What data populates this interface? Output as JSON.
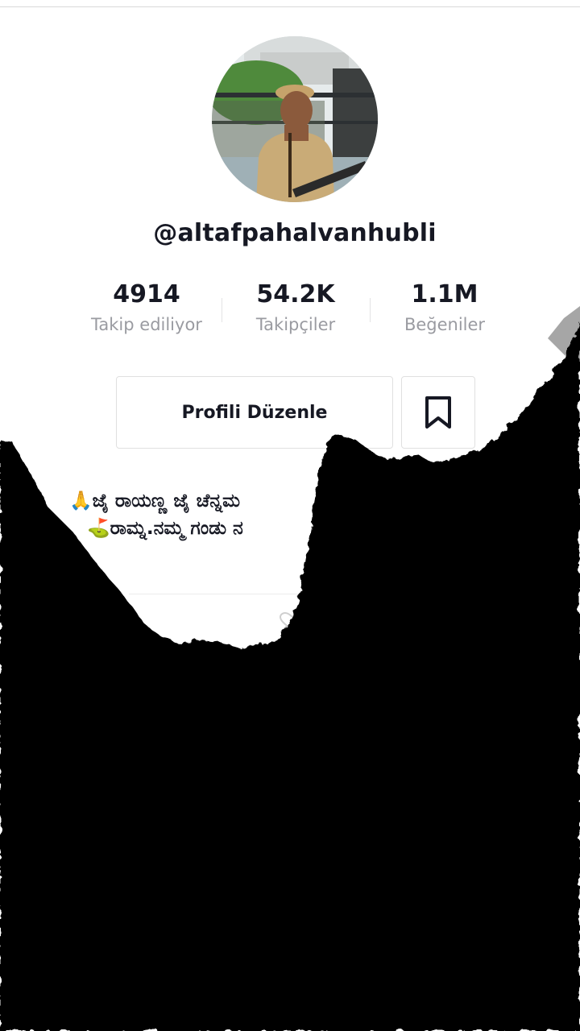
{
  "profile": {
    "username": "@altafpahalvanhubli",
    "avatar_alt": "profile photo"
  },
  "stats": [
    {
      "value": "4914",
      "label": "Takip ediliyor"
    },
    {
      "value": "54.2K",
      "label": "Takipçiler"
    },
    {
      "value": "1.1M",
      "label": "Beğeniler"
    }
  ],
  "actions": {
    "edit_profile_label": "Profili Düzenle",
    "bookmark_icon": "bookmark-icon"
  },
  "bio": {
    "line1": "🙏ಜೈ ರಾಯಣ್ಣ ಜೈ ಚೆನ್ನಮ",
    "line2": "⛳ರಾಮ್ನ.ನಮ್ಮ ಗಂಡು ನ"
  },
  "colors": {
    "text_primary": "#161823",
    "text_secondary": "#9a9ba1",
    "overlay": "#000000"
  }
}
